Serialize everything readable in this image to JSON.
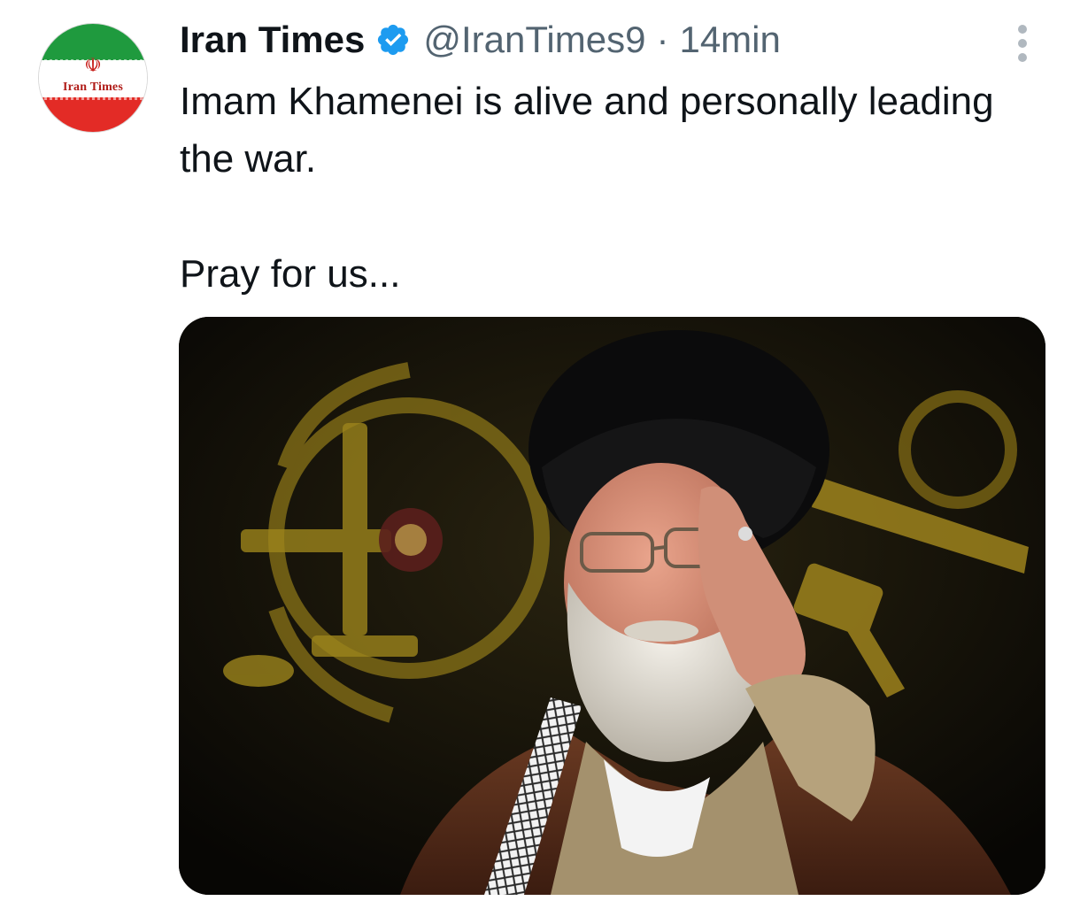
{
  "author": {
    "display_name": "Iran Times",
    "handle": "@IranTimes9",
    "separator": "·",
    "timestamp": "14min",
    "verified": true,
    "avatar_text": "Iran Times",
    "avatar_emblem": "☫"
  },
  "tweet": {
    "line1": "Imam Khamenei is alive and personally leading the war.",
    "line2": "Pray for us..."
  },
  "icons": {
    "verified": "verified-badge-icon",
    "more": "more-options-icon"
  },
  "colors": {
    "verified_blue": "#1d9bf0",
    "secondary_text": "#536471",
    "primary_text": "#0f1419",
    "flag_green": "#1f9a3e",
    "flag_red": "#e32b26"
  }
}
